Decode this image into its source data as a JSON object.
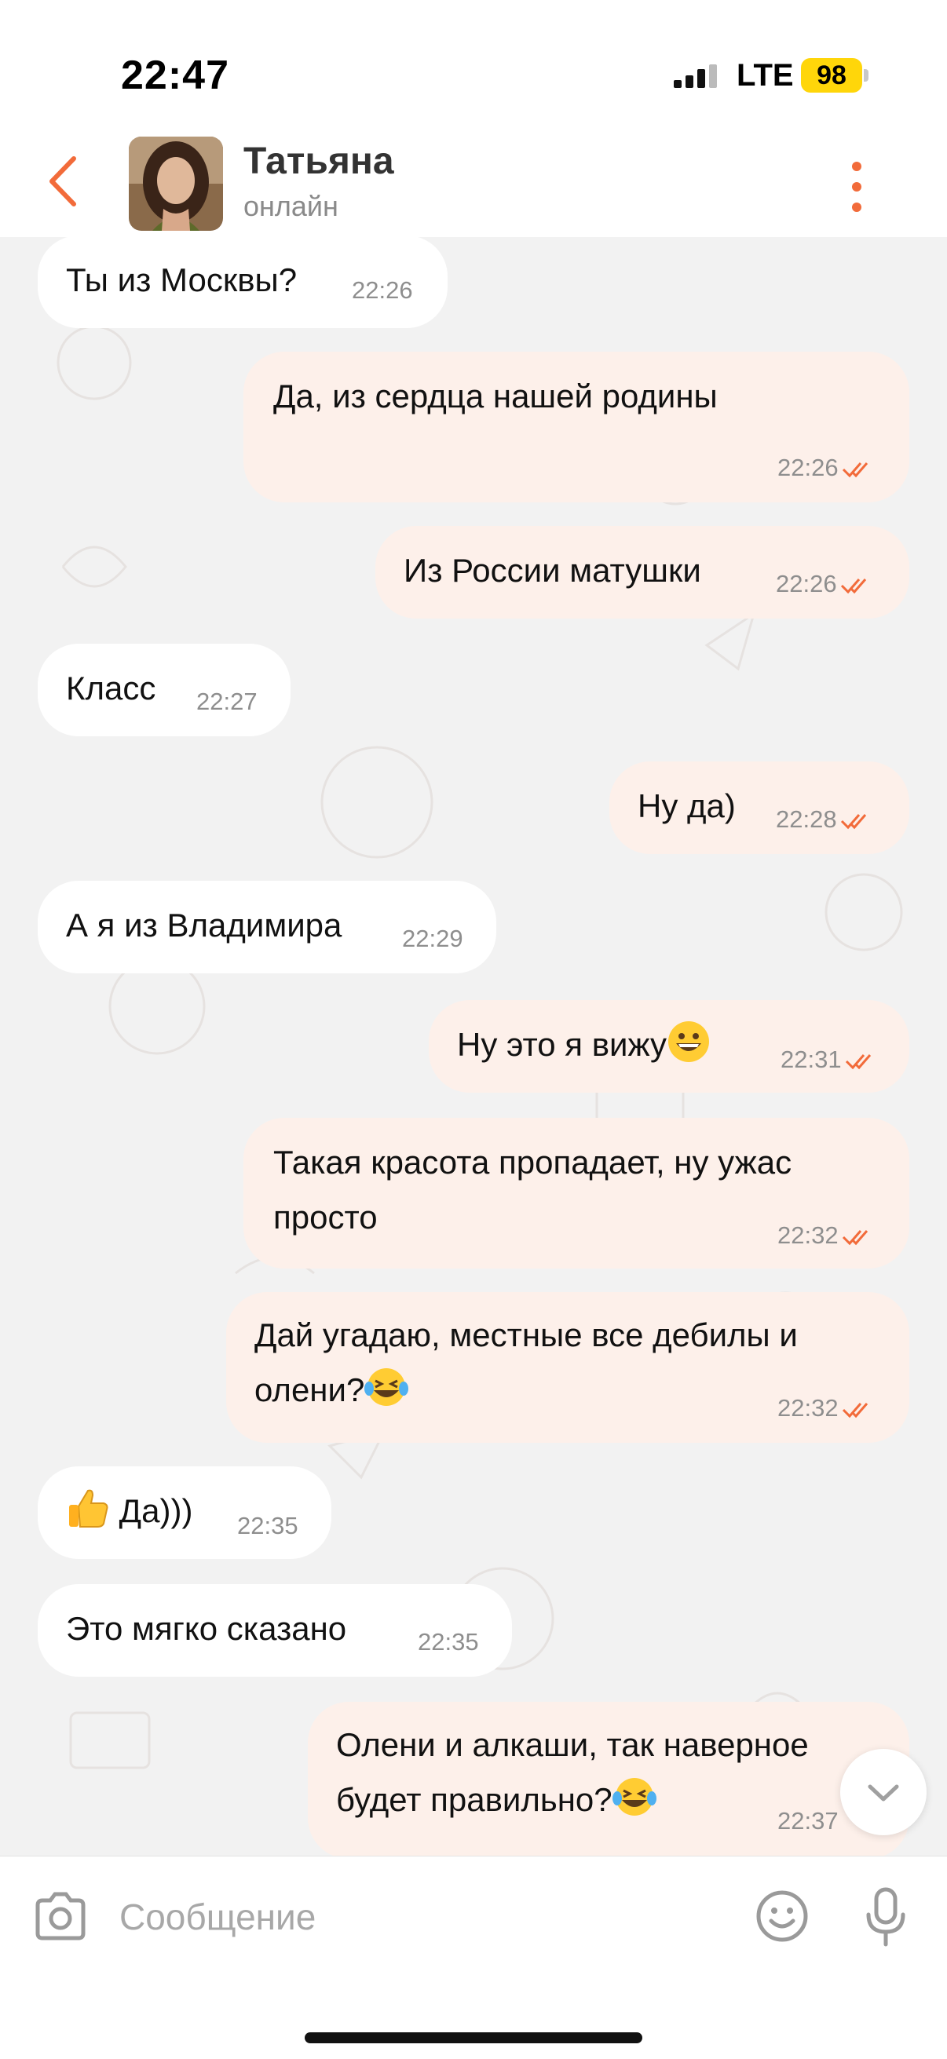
{
  "status_bar": {
    "time": "22:47",
    "network": "LTE",
    "battery": "98"
  },
  "header": {
    "name": "Татьяна",
    "status": "онлайн"
  },
  "messages": [
    {
      "dir": "in",
      "text": "Ты из Москвы?",
      "time": "22:26"
    },
    {
      "dir": "out",
      "text": "Да, из сердца нашей родины",
      "time": "22:26",
      "read": true
    },
    {
      "dir": "out",
      "text": "Из России матушки",
      "time": "22:26",
      "read": true
    },
    {
      "dir": "in",
      "text": "Класс",
      "time": "22:27"
    },
    {
      "dir": "out",
      "text": "Ну да)",
      "time": "22:28",
      "read": true
    },
    {
      "dir": "in",
      "text": "А я из Владимира",
      "time": "22:29"
    },
    {
      "dir": "out",
      "text": "Ну это я вижу",
      "emoji": "grinning-face-emoji",
      "time": "22:31",
      "read": true
    },
    {
      "dir": "out",
      "lines": [
        "Такая красота пропадает, ну ужас",
        "просто"
      ],
      "time": "22:32",
      "read": true
    },
    {
      "dir": "out",
      "lines": [
        "Дай угадаю, местные все дебилы и",
        "олени?"
      ],
      "emoji": "laughing-tears-emoji",
      "time": "22:32",
      "read": true
    },
    {
      "dir": "in",
      "text": "Да)))",
      "emoji_before": "thumbs-up-emoji",
      "time": "22:35"
    },
    {
      "dir": "in",
      "text": "Это мягко сказано",
      "time": "22:35"
    },
    {
      "dir": "out",
      "lines": [
        "Олени и алкаши, так наверное",
        "будет правильно?"
      ],
      "emoji": "laughing-tears-emoji",
      "time": "22:37"
    }
  ],
  "input": {
    "placeholder": "Сообщение"
  },
  "colors": {
    "accent": "#f26b3a",
    "outgoing_bubble": "#fdf0ea",
    "incoming_bubble": "#ffffff",
    "chat_bg": "#f2f2f2"
  }
}
